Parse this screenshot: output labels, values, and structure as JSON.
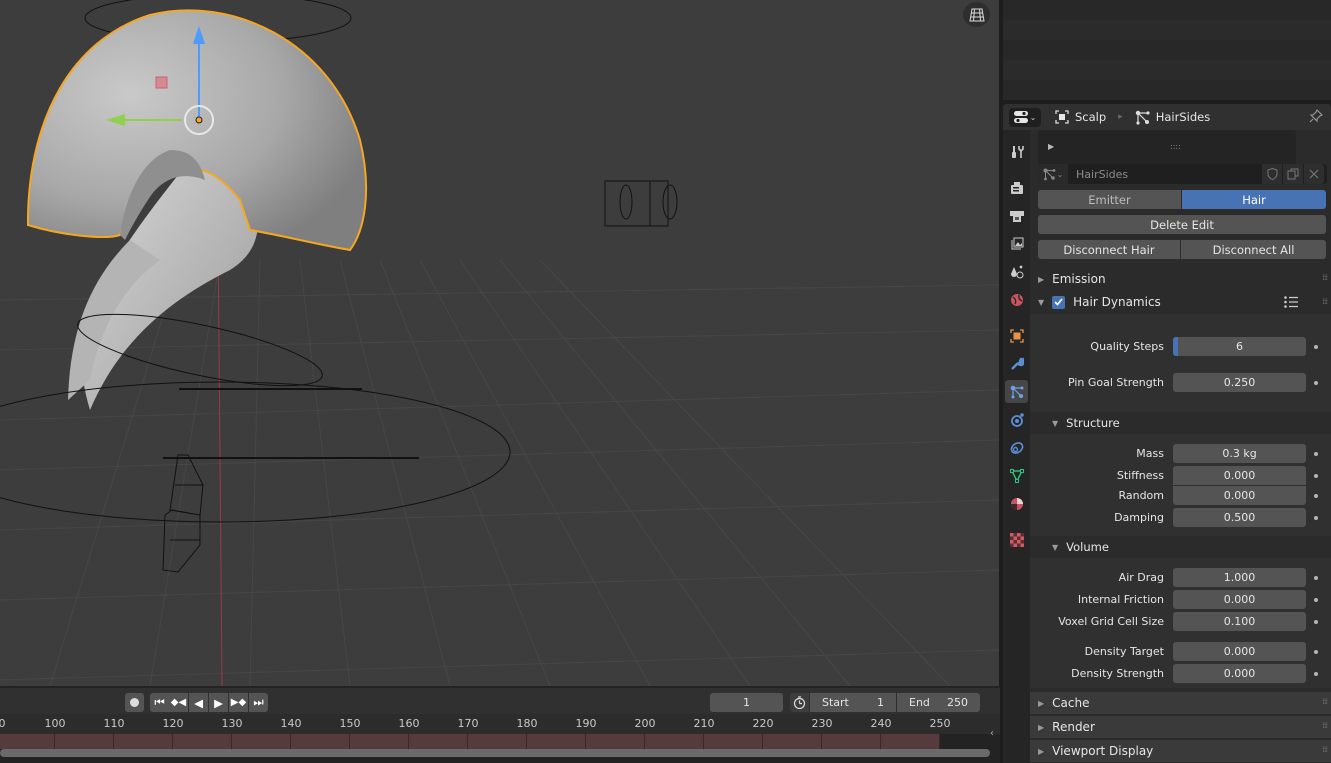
{
  "viewport": {
    "nav_gizmo_icon": "grid-view-icon",
    "colors": {
      "background": "#3d3d3d",
      "selection_outline": "#f5a623",
      "axis_z": "#4c9bff",
      "axis_y": "#8fd14f",
      "axis_x": "#d94b5c"
    }
  },
  "properties": {
    "header": {
      "editor_icon": "properties-editor-icon",
      "breadcrumb": [
        {
          "icon": "object-icon",
          "label": "Scalp"
        },
        {
          "icon": "particles-icon",
          "label": "HairSides"
        }
      ],
      "pin_icon": "pin-icon"
    },
    "tabs": [
      {
        "name": "tool",
        "icon": "tool-icon",
        "active": false
      },
      {
        "name": "render",
        "icon": "render-icon",
        "active": false
      },
      {
        "name": "output",
        "icon": "output-icon",
        "active": false
      },
      {
        "name": "view-layer",
        "icon": "view-layer-icon",
        "active": false
      },
      {
        "name": "scene",
        "icon": "scene-icon",
        "active": false
      },
      {
        "name": "world",
        "icon": "world-icon",
        "active": false
      },
      {
        "name": "object",
        "icon": "object-icon",
        "active": false
      },
      {
        "name": "modifiers",
        "icon": "wrench-icon",
        "active": false
      },
      {
        "name": "particles",
        "icon": "particles-icon",
        "active": true
      },
      {
        "name": "physics",
        "icon": "physics-icon",
        "active": false
      },
      {
        "name": "constraints",
        "icon": "constraints-icon",
        "active": false
      },
      {
        "name": "data",
        "icon": "mesh-data-icon",
        "active": false
      },
      {
        "name": "material",
        "icon": "material-icon",
        "active": false
      },
      {
        "name": "texture",
        "icon": "texture-icon",
        "active": false
      }
    ],
    "particle_system": {
      "name": "HairSides",
      "type_options": [
        "Emitter",
        "Hair"
      ],
      "type_selected": "Hair",
      "delete_edit": "Delete Edit",
      "disconnect_hair": "Disconnect Hair",
      "disconnect_all": "Disconnect All"
    },
    "panels": {
      "emission": "Emission",
      "hair_dynamics": {
        "label": "Hair Dynamics",
        "enabled": true,
        "quality_steps": {
          "label": "Quality Steps",
          "value": "6"
        },
        "pin_goal_strength": {
          "label": "Pin Goal Strength",
          "value": "0.250"
        },
        "structure": {
          "label": "Structure",
          "mass": {
            "label": "Mass",
            "value": "0.3 kg"
          },
          "stiffness": {
            "label": "Stiffness",
            "value": "0.000"
          },
          "random": {
            "label": "Random",
            "value": "0.000"
          },
          "damping": {
            "label": "Damping",
            "value": "0.500"
          }
        },
        "volume": {
          "label": "Volume",
          "air_drag": {
            "label": "Air Drag",
            "value": "1.000"
          },
          "internal_friction": {
            "label": "Internal Friction",
            "value": "0.000"
          },
          "voxel_grid_cell_size": {
            "label": "Voxel Grid Cell Size",
            "value": "0.100"
          },
          "density_target": {
            "label": "Density Target",
            "value": "0.000"
          },
          "density_strength": {
            "label": "Density Strength",
            "value": "0.000"
          }
        }
      },
      "cache": "Cache",
      "render": "Render",
      "viewport_display": "Viewport Display"
    }
  },
  "timeline": {
    "current_frame": "1",
    "start_label": "Start",
    "start_value": "1",
    "end_label": "End",
    "end_value": "250",
    "ruler_ticks": [
      "0",
      "100",
      "110",
      "120",
      "130",
      "140",
      "150",
      "160",
      "170",
      "180",
      "190",
      "200",
      "210",
      "220",
      "230",
      "240",
      "250"
    ]
  }
}
